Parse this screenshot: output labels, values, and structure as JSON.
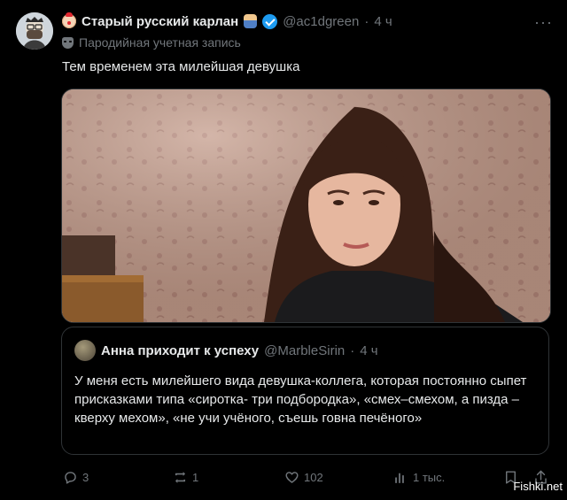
{
  "author": {
    "display_name": "Старый русский карлан",
    "handle": "@ac1dgreen",
    "separator": "·",
    "time": "4 ч",
    "label": "Пародийная учетная запись"
  },
  "tweet": {
    "text": "Тем временем эта милейшая девушка"
  },
  "quote": {
    "display_name": "Анна приходит к успеху",
    "handle": "@MarbleSirin",
    "separator": "·",
    "time": "4 ч",
    "text": "У меня есть милейшего вида девушка-коллега, которая постоянно сыпет присказками типа «сиротка- три подбородка», «смех–смехом, а пизда – кверху мехом», «не учи учёного, съешь говна печёного»"
  },
  "actions": {
    "replies": "3",
    "reposts": "1",
    "likes": "102",
    "views": "1 тыс."
  },
  "watermark": "Fishki.net",
  "icons": [
    "more-icon",
    "verified-icon",
    "mask-icon",
    "reply-icon",
    "repost-icon",
    "like-icon",
    "views-icon",
    "bookmark-icon",
    "share-icon"
  ]
}
